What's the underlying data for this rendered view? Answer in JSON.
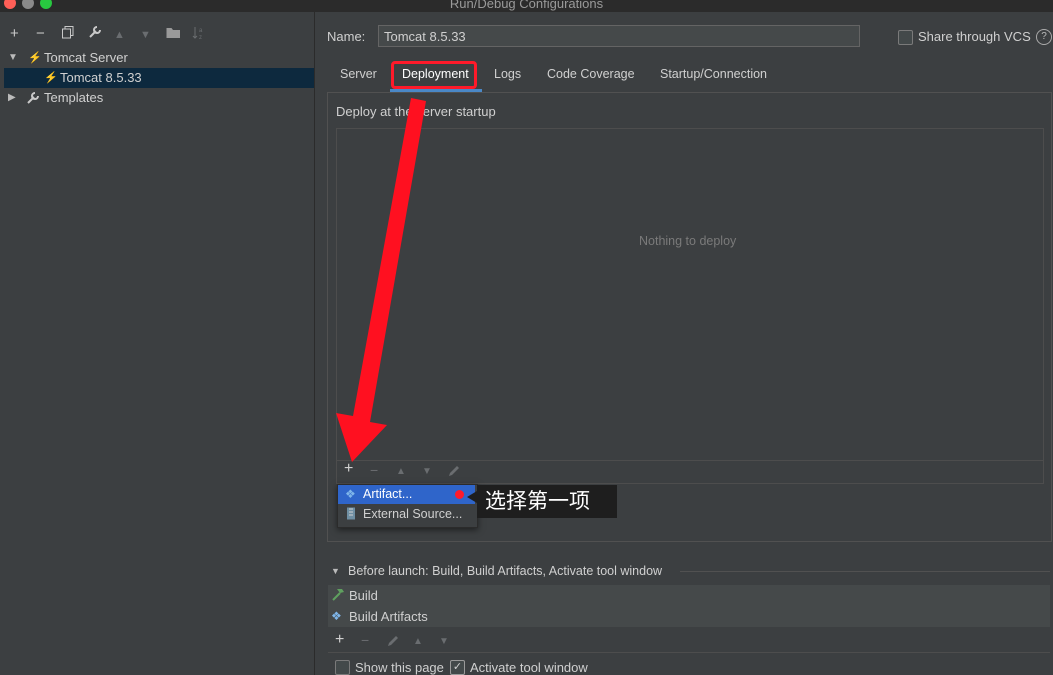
{
  "window": {
    "title": "Run/Debug Configurations"
  },
  "left_toolbar": {
    "add": "+",
    "remove": "−",
    "copy_icon": "copy-icon",
    "wrench_icon": "wrench-icon",
    "up": "▲",
    "down": "▼",
    "folder_icon": "folder-icon",
    "sort_icon": "sort-icon"
  },
  "tree": {
    "group": {
      "label": "Tomcat Server",
      "expanded": true
    },
    "child": {
      "label": "Tomcat 8.5.33",
      "selected": true
    },
    "templates": {
      "label": "Templates",
      "expanded": false
    }
  },
  "form": {
    "name_label": "Name:",
    "name_value": "Tomcat 8.5.33",
    "share_label": "Share through VCS",
    "share_checked": false,
    "help": "?"
  },
  "tabs": [
    "Server",
    "Deployment",
    "Logs",
    "Code Coverage",
    "Startup/Connection"
  ],
  "active_tab": "Deployment",
  "deployment": {
    "group_title": "Deploy at the server startup",
    "empty_text": "Nothing to deploy",
    "toolbar": {
      "add": "+",
      "remove": "−",
      "up": "▲",
      "down": "▼",
      "edit_icon": "pencil-icon"
    }
  },
  "popup_menu": {
    "items": [
      {
        "label": "Artifact...",
        "icon": "artifact-icon",
        "highlighted": true
      },
      {
        "label": "External Source...",
        "icon": "archive-icon",
        "highlighted": false
      }
    ]
  },
  "annotation": {
    "text": "选择第一项",
    "color": "#ff1a2a"
  },
  "before_launch": {
    "title": "Before launch: Build, Build Artifacts, Activate tool window",
    "items": [
      {
        "label": "Build",
        "icon": "hammer-icon"
      },
      {
        "label": "Build Artifacts",
        "icon": "artifact-icon"
      }
    ],
    "toolbar": {
      "add": "+",
      "remove": "−",
      "up": "▲",
      "down": "▼",
      "edit_icon": "pencil-icon"
    }
  },
  "footer": {
    "show_page_label": "Show this page",
    "show_page_checked": false,
    "activate_label": "Activate tool window",
    "activate_checked": true
  },
  "colors": {
    "background": "#3c3f41",
    "selection": "#0d293e",
    "menu_highlight": "#2f65ca",
    "annotation_red": "#ff1a2a",
    "tab_underline": "#4a88c7"
  }
}
